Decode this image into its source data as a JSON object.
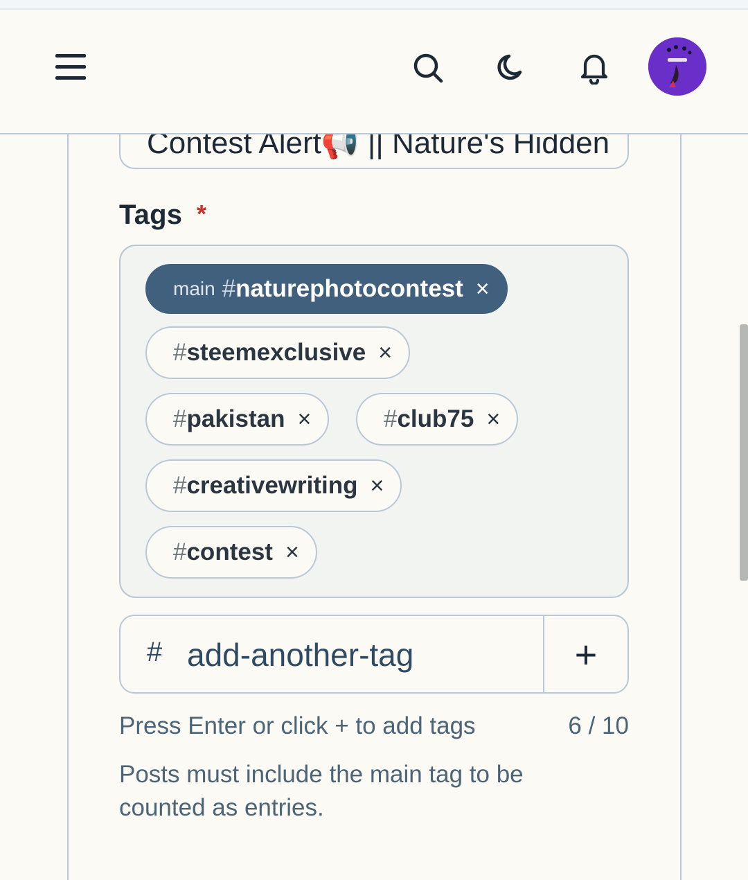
{
  "header": {
    "menu_icon": "hamburger-menu-icon",
    "search_icon": "search-icon",
    "theme_icon": "moon-icon",
    "notifications_icon": "bell-icon",
    "avatar_icon": "user-avatar"
  },
  "title_field": {
    "value": "Contest Alert📢 || Nature's Hidden"
  },
  "tags": {
    "label": "Tags",
    "required_mark": "*",
    "main_tag": {
      "prefix": "main",
      "hash": "#",
      "name": "naturephotocontest",
      "remove": "×"
    },
    "items": [
      {
        "hash": "#",
        "name": "steemexclusive",
        "remove": "×"
      },
      {
        "hash": "#",
        "name": "pakistan",
        "remove": "×"
      },
      {
        "hash": "#",
        "name": "club75",
        "remove": "×"
      },
      {
        "hash": "#",
        "name": "creativewriting",
        "remove": "×"
      },
      {
        "hash": "#",
        "name": "contest",
        "remove": "×"
      }
    ]
  },
  "add_tag": {
    "hash": "#",
    "placeholder": "add-another-tag",
    "add_button": "+"
  },
  "hint": "Press Enter or click + to add tags",
  "counter": "6 / 10",
  "note": "Posts must include the main tag to be counted as entries.",
  "colors": {
    "accent": "#41607d",
    "border": "#b9c8d6",
    "background": "#fbfaf5",
    "required": "#c8342c",
    "avatar": "#6a2fc8"
  }
}
